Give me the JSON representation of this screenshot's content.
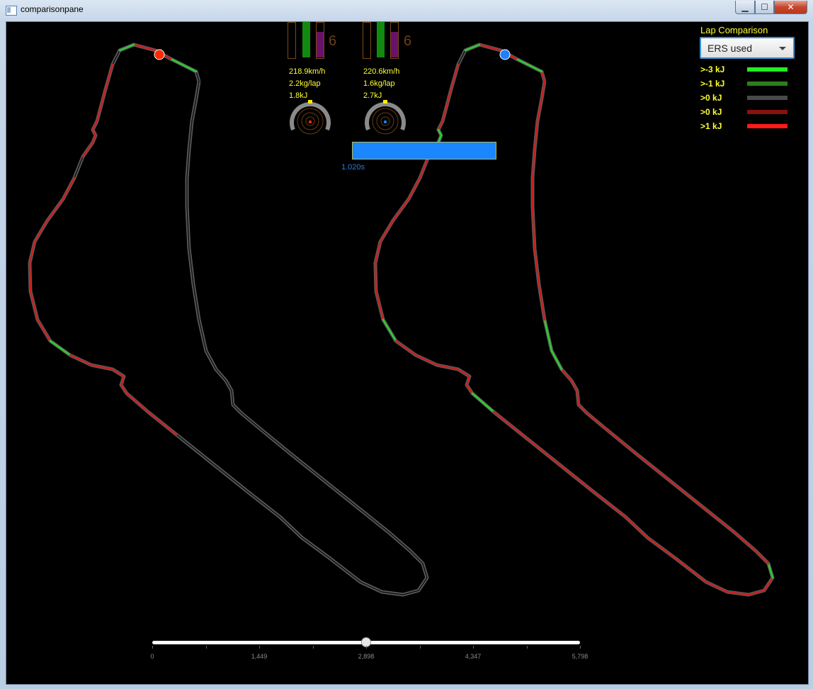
{
  "window": {
    "title": "comparisonpane",
    "minimize": "▁",
    "maximize": "☐",
    "close": "✕"
  },
  "colors": {
    "background": "#000000",
    "track_gray": "#4a4a4a",
    "track_red": "#c81e1e",
    "track_green": "#2ecc2e",
    "accent_yellow": "#ffff33",
    "driver_a": "#ff2a00",
    "driver_b": "#1f7fff"
  },
  "drivers": [
    {
      "speed": "218.9km/h",
      "fuel": "2.2kg/lap",
      "energy": "1.8kJ",
      "gear": "6",
      "bars": {
        "throttle": 1.0,
        "ers": 0.72
      },
      "marker_color": "#ff2a00"
    },
    {
      "speed": "220.6km/h",
      "fuel": "1.6kg/lap",
      "energy": "2.7kJ",
      "gear": "6",
      "bars": {
        "throttle": 1.0,
        "ers": 0.72
      },
      "marker_color": "#1f7fff"
    }
  ],
  "gap": {
    "label": "1.020s"
  },
  "lap_comparison": {
    "title": "Lap Comparison",
    "selected": "ERS used",
    "legend": [
      {
        "label": ">-3 kJ",
        "color": "#22ee22"
      },
      {
        "label": ">-1 kJ",
        "color": "#2e7d1e"
      },
      {
        "label": ">0 kJ",
        "color": "#4a4a4a"
      },
      {
        "label": ">0 kJ",
        "color": "#8b1010"
      },
      {
        "label": ">1 kJ",
        "color": "#ff1a1a"
      }
    ]
  },
  "slider": {
    "min": 0,
    "max": 5798,
    "value": 2898,
    "tick_labels": [
      "0",
      "1,449",
      "2,898",
      "4,347",
      "5,798"
    ]
  }
}
